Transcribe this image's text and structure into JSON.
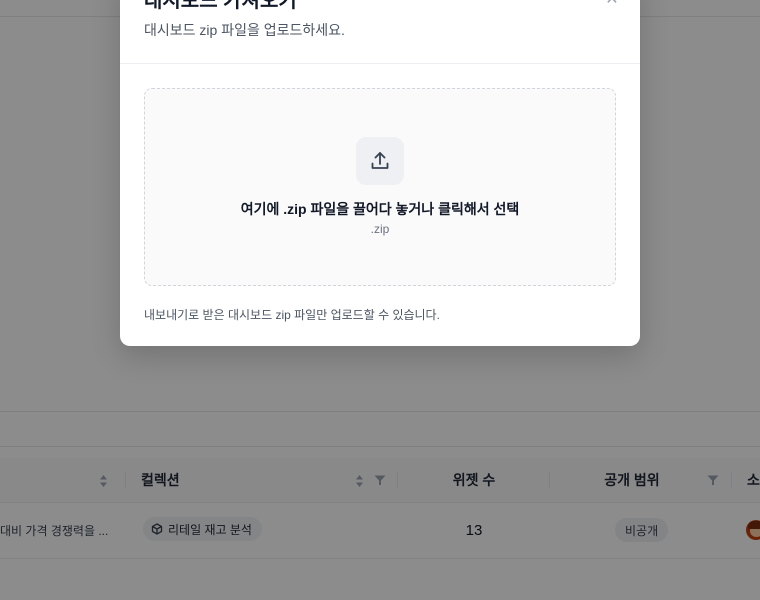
{
  "background": {
    "table": {
      "columns": [
        {
          "label": "컬렉션"
        },
        {
          "label": "위젯 수"
        },
        {
          "label": "공개 범위"
        },
        {
          "label": "소"
        }
      ],
      "row": {
        "description": "대비 가격 경쟁력을 ...",
        "collection": "리테일 재고 분석",
        "widget_count": "13",
        "visibility": "비공개"
      }
    }
  },
  "modal": {
    "title": "대시보드 가져오기",
    "subtitle": "대시보드 zip 파일을 업로드하세요.",
    "dropzone": {
      "main_text": "여기에 .zip 파일을 끌어다 놓거나 클릭해서 선택",
      "accepted_ext": ".zip",
      "icon": "upload-icon"
    },
    "help_text": "내보내기로 받은 대시보드 zip 파일만 업로드할 수 있습니다.",
    "close_icon": "close-icon"
  },
  "colors": {
    "overlay": "#737373",
    "modal_bg": "#ffffff",
    "dropzone_border": "#d1d5db"
  }
}
